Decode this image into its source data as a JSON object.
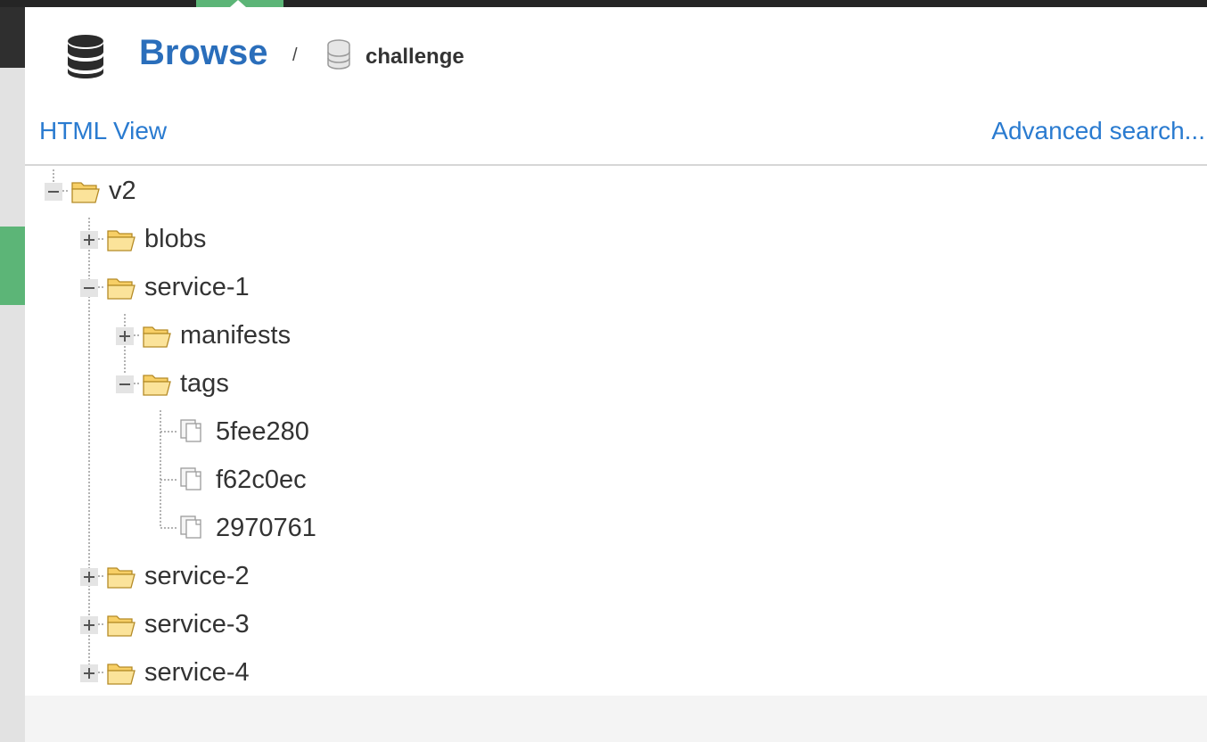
{
  "header": {
    "title": "Browse",
    "separator": "/",
    "repository": "challenge"
  },
  "links": {
    "html_view": "HTML View",
    "advanced_search": "Advanced search..."
  },
  "tree": {
    "root": {
      "label": "v2",
      "state": "expanded"
    },
    "blobs": {
      "label": "blobs",
      "state": "collapsed"
    },
    "service1": {
      "label": "service-1",
      "state": "expanded"
    },
    "manifests": {
      "label": "manifests",
      "state": "collapsed"
    },
    "tags": {
      "label": "tags",
      "state": "expanded"
    },
    "tag1": {
      "label": "5fee280"
    },
    "tag2": {
      "label": "f62c0ec"
    },
    "tag3": {
      "label": "2970761"
    },
    "service2": {
      "label": "service-2",
      "state": "collapsed"
    },
    "service3": {
      "label": "service-3",
      "state": "collapsed"
    },
    "service4": {
      "label": "service-4",
      "state": "collapsed"
    }
  },
  "colors": {
    "link": "#2a7bd0",
    "title": "#2a6ebb",
    "accent_green": "#5cb577",
    "folder": "#f7cf66"
  },
  "icons": {
    "header": "database-icon",
    "repository": "database-icon",
    "folder": "folder-open-icon",
    "file": "file-copy-icon",
    "expand": "plus-icon",
    "collapse": "minus-icon"
  }
}
